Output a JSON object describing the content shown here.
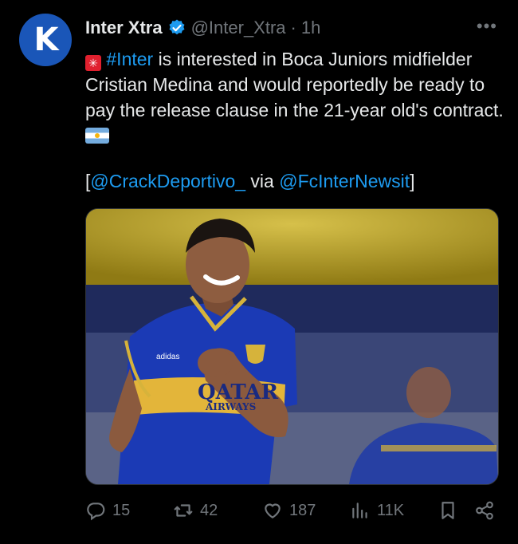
{
  "tweet": {
    "author_name": "Inter Xtra",
    "author_handle": "@Inter_Xtra",
    "separator": "·",
    "time": "1h",
    "avatar_letter": "K",
    "more_label": "•••",
    "text_hashtag": "#Inter",
    "text_body": " is interested in Boca Juniors midfielder Cristian Medina and would reportedly be ready to pay the release clause in the 21-year old's contract.",
    "source_open": "[",
    "source_mention_1": "@CrackDeportivo_",
    "source_via": " via ",
    "source_mention_2": "@FcInterNewsit",
    "source_close": "]",
    "image_jersey_text_1": "QATAR",
    "image_jersey_text_2": "AIRWAYS",
    "image_brand_text": "adidas"
  },
  "actions": {
    "replies": "15",
    "retweets": "42",
    "likes": "187",
    "views": "11K"
  },
  "colors": {
    "background": "#000000",
    "text": "#e7e9ea",
    "muted": "#71767b",
    "link": "#1d9bf0",
    "avatar": "#1a56b8"
  },
  "icons": [
    "verified-badge-icon",
    "more-icon",
    "siren-emoji-icon",
    "argentina-flag-icon",
    "reply-icon",
    "retweet-icon",
    "like-icon",
    "views-icon",
    "bookmark-icon",
    "share-icon"
  ]
}
